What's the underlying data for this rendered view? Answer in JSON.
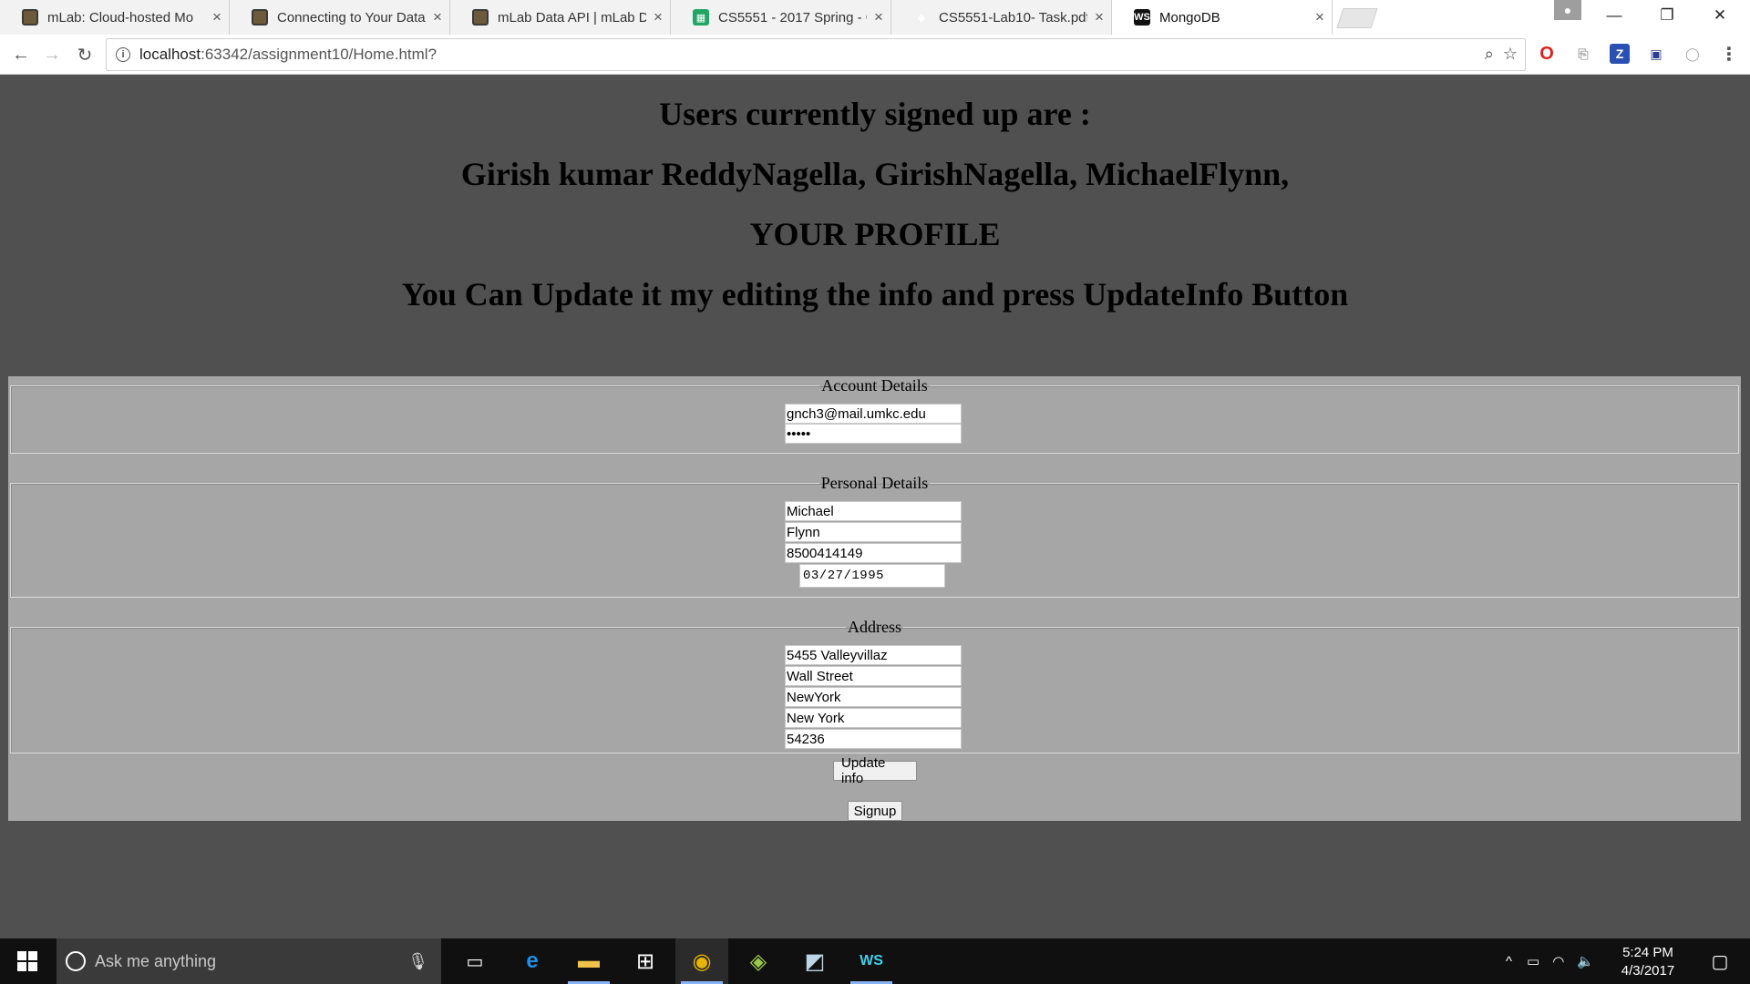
{
  "browser": {
    "tabs": [
      {
        "title": "mLab: Cloud-hosted Mo",
        "favicon": "mlab-icon"
      },
      {
        "title": "Connecting to Your Data",
        "favicon": "mlab-icon"
      },
      {
        "title": "mLab Data API | mLab D",
        "favicon": "mlab-icon"
      },
      {
        "title": "CS5551 - 2017 Spring - G",
        "favicon": "sheets-icon"
      },
      {
        "title": "CS5551-Lab10- Task.pdf",
        "favicon": "dropbox-icon"
      },
      {
        "title": "MongoDB",
        "favicon": "webstorm-icon",
        "active": true
      }
    ],
    "url_host": "localhost",
    "url_rest": ":63342/assignment10/Home.html?"
  },
  "page": {
    "heading_users": "Users currently signed up are :",
    "heading_names": "Girish kumar ReddyNagella, GirishNagella, MichaelFlynn,",
    "heading_profile": "YOUR PROFILE",
    "heading_instructions": "You Can Update it my editing the info and press UpdateInfo Button",
    "account": {
      "legend": "Account Details",
      "email": "gnch3@mail.umkc.edu",
      "password": "•••••"
    },
    "personal": {
      "legend": "Personal Details",
      "first_name": "Michael",
      "last_name": "Flynn",
      "phone": "8500414149",
      "dob": "03/27/1995"
    },
    "address": {
      "legend": "Address",
      "line1": "5455 Valleyvillaz",
      "line2": "Wall Street",
      "city": "NewYork",
      "state": "New York",
      "zip": "54236"
    },
    "update_button": "Update info",
    "signup_button": "Signup"
  },
  "taskbar": {
    "search_placeholder": "Ask me anything",
    "time": "5:24 PM",
    "date": "4/3/2017"
  },
  "colors": {
    "page_background": "#505050",
    "form_background": "#a6a6a6",
    "taskbar": "#101010"
  }
}
